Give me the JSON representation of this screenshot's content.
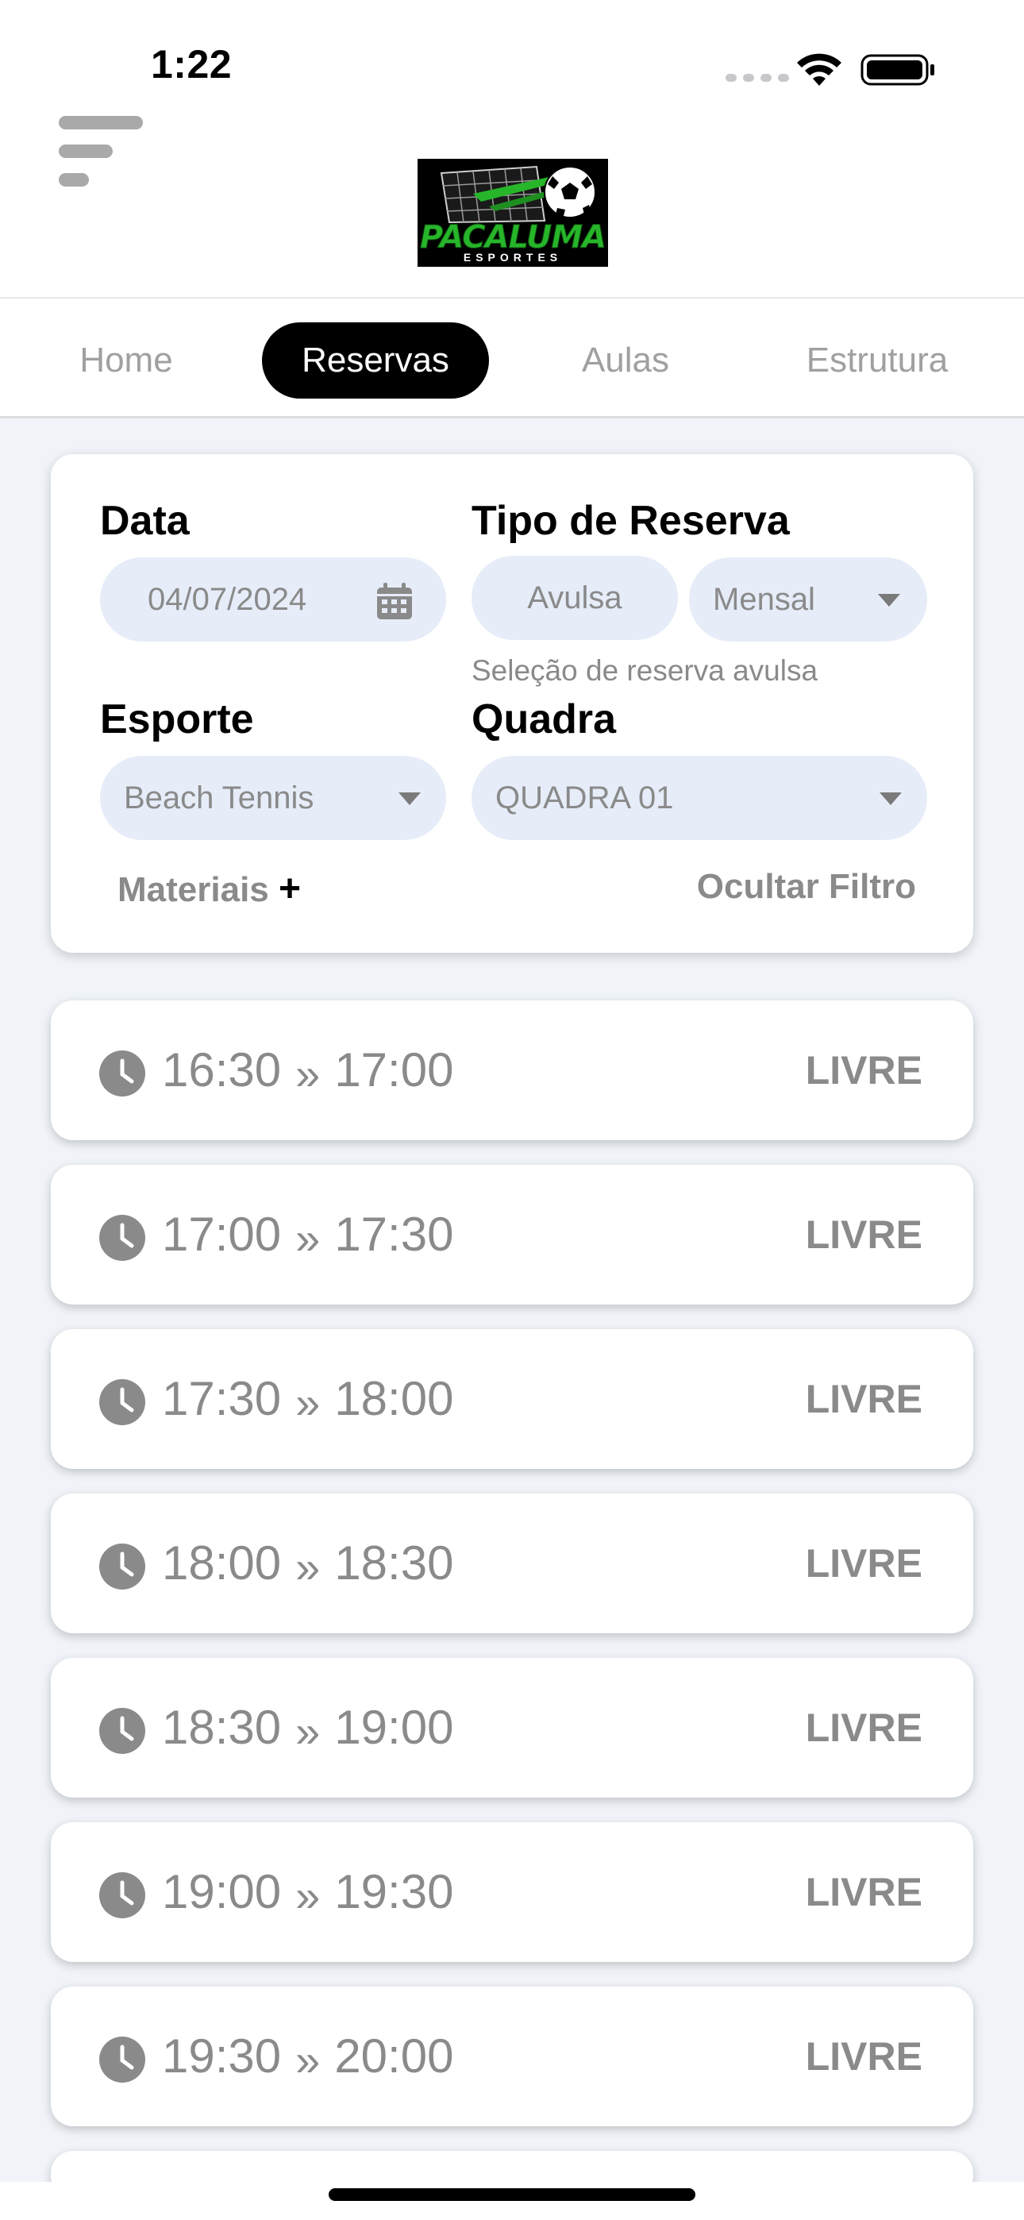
{
  "status_bar": {
    "time": "1:22"
  },
  "logo": {
    "title": "PACALUMA",
    "subtitle": "ESPORTES"
  },
  "tabs": [
    {
      "label": "Home",
      "active": false
    },
    {
      "label": "Reservas",
      "active": true
    },
    {
      "label": "Aulas",
      "active": false
    },
    {
      "label": "Estrutura",
      "active": false
    }
  ],
  "filter": {
    "date_label": "Data",
    "date_value": "04/07/2024",
    "type_label": "Tipo de Reserva",
    "type_option_avulsa": "Avulsa",
    "type_option_mensal": "Mensal",
    "type_hint": "Seleção de reserva avulsa",
    "sport_label": "Esporte",
    "sport_value": "Beach Tennis",
    "court_label": "Quadra",
    "court_value": "QUADRA 01",
    "materials_label": "Materiais",
    "materials_plus": "+",
    "hide_filter_label": "Ocultar Filtro"
  },
  "slots": [
    {
      "start": "16:30",
      "end": "17:00",
      "status": "LIVRE"
    },
    {
      "start": "17:00",
      "end": "17:30",
      "status": "LIVRE"
    },
    {
      "start": "17:30",
      "end": "18:00",
      "status": "LIVRE"
    },
    {
      "start": "18:00",
      "end": "18:30",
      "status": "LIVRE"
    },
    {
      "start": "18:30",
      "end": "19:00",
      "status": "LIVRE"
    },
    {
      "start": "19:00",
      "end": "19:30",
      "status": "LIVRE"
    },
    {
      "start": "19:30",
      "end": "20:00",
      "status": "LIVRE"
    }
  ],
  "arrow_glyph": "»",
  "colors": {
    "active_tab_bg": "#000000",
    "pill_bg": "#e6ecf8",
    "muted_text": "#8a8a8a",
    "logo_green": "#27b52a",
    "page_bg": "#f0f4f8"
  }
}
